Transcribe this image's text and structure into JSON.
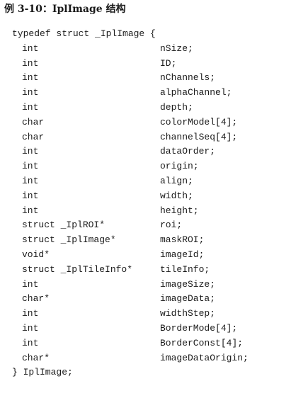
{
  "caption": "例 3-10：IplImage 结构",
  "code": {
    "header": "typedef struct _IplImage {",
    "members": [
      {
        "type": "int",
        "name": "nSize;"
      },
      {
        "type": "int",
        "name": "ID;"
      },
      {
        "type": "int",
        "name": "nChannels;"
      },
      {
        "type": "int",
        "name": "alphaChannel;"
      },
      {
        "type": "int",
        "name": "depth;"
      },
      {
        "type": "char",
        "name": "colorModel[4];"
      },
      {
        "type": "char",
        "name": "channelSeq[4];"
      },
      {
        "type": "int",
        "name": "dataOrder;"
      },
      {
        "type": "int",
        "name": "origin;"
      },
      {
        "type": "int",
        "name": "align;"
      },
      {
        "type": "int",
        "name": "width;"
      },
      {
        "type": "int",
        "name": "height;"
      },
      {
        "type": "struct _IplROI*",
        "name": "roi;"
      },
      {
        "type": "struct _IplImage*",
        "name": "maskROI;"
      },
      {
        "type": "void*",
        "name": "imageId;"
      },
      {
        "type": "struct _IplTileInfo*",
        "name": "tileInfo;"
      },
      {
        "type": "int",
        "name": "imageSize;"
      },
      {
        "type": "char*",
        "name": "imageData;"
      },
      {
        "type": "int",
        "name": "widthStep;"
      },
      {
        "type": "int",
        "name": "BorderMode[4];"
      },
      {
        "type": "int",
        "name": "BorderConst[4];"
      },
      {
        "type": "char*",
        "name": "imageDataOrigin;"
      }
    ],
    "footer": "} IplImage;"
  }
}
